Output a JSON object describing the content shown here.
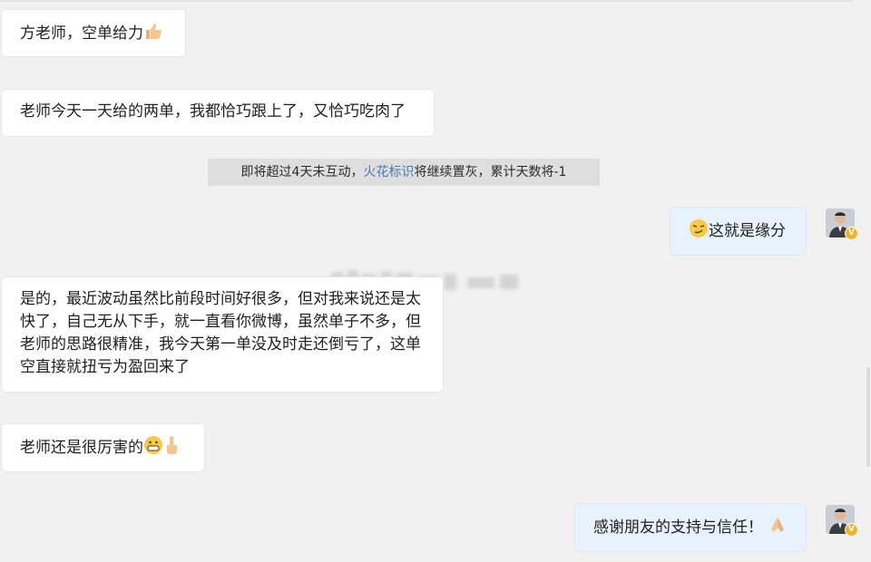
{
  "messages": {
    "m1": "方老师，空单给力",
    "m2": "老师今天一天给的两单，我都恰巧跟上了，又恰巧吃肉了",
    "m4": "这就是缘分",
    "m5": "是的，最近波动虽然比前段时间好很多，但对我来说还是太快了，自己无从下手，就一直看你微博，虽然单子不多，但老师的思路很精准，我今天第一单没及时走还倒亏了，这单空直接就扭亏为盈回来了",
    "m6": "老师还是很厉害的",
    "m7": "感谢朋友的支持与信任！"
  },
  "system_notice": {
    "before": "即将超过4天未互动，",
    "link": "火花标识",
    "after": "将继续置灰，累计天数将-1"
  },
  "icons": {
    "thumbs_up": "thumbs-up-icon",
    "smirk_face": "smirk-face-icon",
    "grin_face": "grin-face-icon",
    "pointing_hand": "pointing-hand-icon",
    "praying_hands": "praying-hands-icon",
    "verified_badge": "verified-badge-icon"
  },
  "colors": {
    "background": "#f1f1f1",
    "bubble_left": "#ffffff",
    "bubble_right": "#e8f2fc",
    "system_bg": "#dedede",
    "link": "#4a79b4",
    "badge": "#f1b02b"
  },
  "avatar_badge_text": "V"
}
